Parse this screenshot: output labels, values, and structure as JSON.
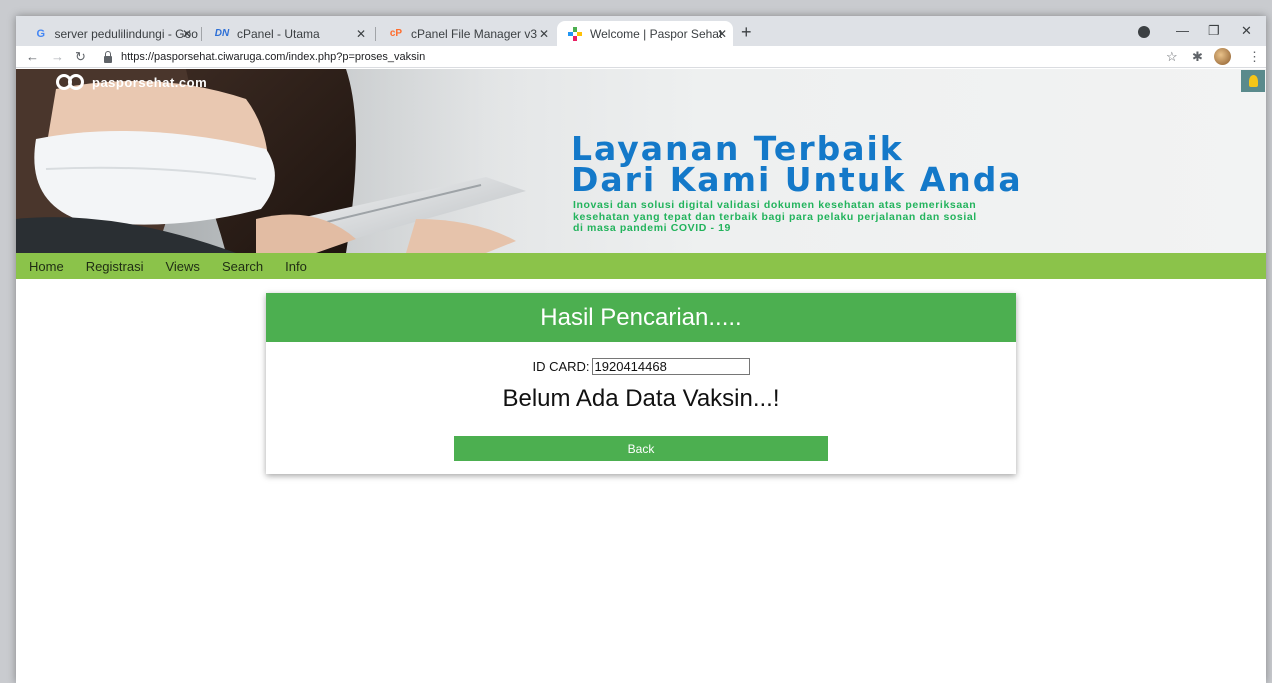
{
  "browser": {
    "tabs": [
      {
        "title": "server pedulilindungi - Google S",
        "favicon": "google-g-icon",
        "active": false
      },
      {
        "title": "cPanel - Utama",
        "favicon": "dn-icon",
        "active": false
      },
      {
        "title": "cPanel File Manager v3",
        "favicon": "cpanel-icon",
        "active": false
      },
      {
        "title": "Welcome | Paspor Sehat",
        "favicon": "paspor-sehat-icon",
        "active": true
      }
    ],
    "url": "https://pasporsehat.ciwaruga.com/index.php?p=proses_vaksin",
    "colors": {
      "tabstrip": "#dee1e6",
      "active_tab": "#ffffff"
    }
  },
  "banner": {
    "logo_text": "pasporsehat.com",
    "headline_line1": "Layanan Terbaik",
    "headline_line2": "Dari Kami Untuk Anda",
    "tagline_line1": "Inovasi dan solusi digital validasi dokumen kesehatan atas pemeriksaan",
    "tagline_line2": "kesehatan yang tepat dan terbaik bagi para pelaku perjalanan dan sosial",
    "tagline_line3": "di masa pandemi COVID - 19",
    "colors": {
      "headline": "#1479c9",
      "tagline": "#22b35c"
    }
  },
  "menu": {
    "items": [
      {
        "label": "Home"
      },
      {
        "label": "Registrasi"
      },
      {
        "label": "Views"
      },
      {
        "label": "Search"
      },
      {
        "label": "Info"
      }
    ],
    "color": "#8bc34a"
  },
  "result": {
    "title": "Hasil Pencarian.....",
    "id_label": "ID CARD:",
    "id_value": "1920414468",
    "message": "Belum Ada Data Vaksin...!",
    "back_label": "Back",
    "color": "#4caf50"
  }
}
